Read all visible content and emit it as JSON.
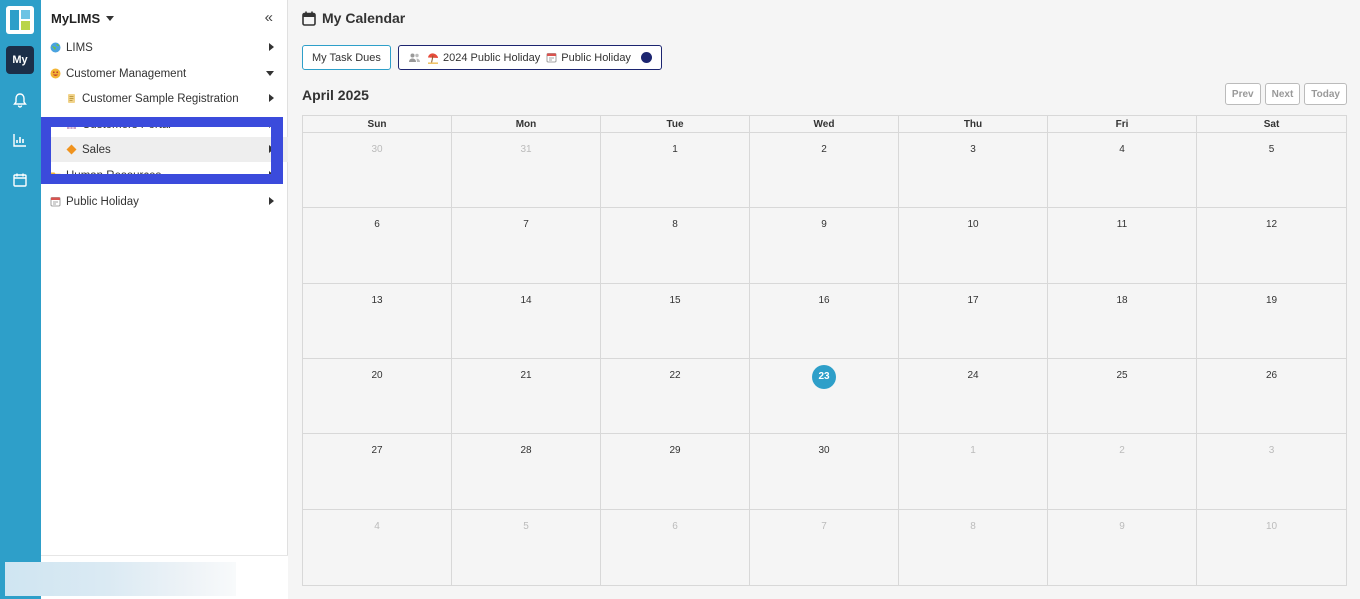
{
  "rail": {
    "my_label": "My",
    "icons": [
      "bell-icon",
      "chart-icon",
      "calendar-icon"
    ]
  },
  "sidebar": {
    "title": "MyLIMS",
    "collapse_glyph": "«",
    "items": [
      {
        "label": "LIMS",
        "icon": "globe-icon"
      },
      {
        "label": "Customer Management",
        "icon": "smiley-icon"
      },
      {
        "label": "Customer Sample Registration",
        "icon": "scroll-icon"
      },
      {
        "label": "Customers Portal",
        "icon": "grid-icon"
      },
      {
        "label": "Sales",
        "icon": "diamond-icon"
      },
      {
        "label": "Human Resources",
        "icon": "folder-icon"
      },
      {
        "label": "Public Holiday",
        "icon": "calendar-icon"
      }
    ]
  },
  "main": {
    "title": "My Calendar",
    "task_button": "My Task Dues",
    "filters": [
      "2024 Public Holiday",
      "Public Holiday"
    ],
    "month": "April 2025",
    "nav": {
      "prev": "Prev",
      "next": "Next",
      "today": "Today"
    },
    "weekdays": [
      "Sun",
      "Mon",
      "Tue",
      "Wed",
      "Thu",
      "Fri",
      "Sat"
    ],
    "days": [
      "30",
      "31",
      "1",
      "2",
      "3",
      "4",
      "5",
      "6",
      "7",
      "8",
      "9",
      "10",
      "11",
      "12",
      "13",
      "14",
      "15",
      "16",
      "17",
      "18",
      "19",
      "20",
      "21",
      "22",
      "23",
      "24",
      "25",
      "26",
      "27",
      "28",
      "29",
      "30",
      "1",
      "2",
      "3",
      "4",
      "5",
      "6",
      "7",
      "8",
      "9",
      "10"
    ],
    "today": "23"
  },
  "colors": {
    "accent": "#2e9fc9",
    "navy": "#1c2570",
    "highlight": "#3b4bdc"
  }
}
